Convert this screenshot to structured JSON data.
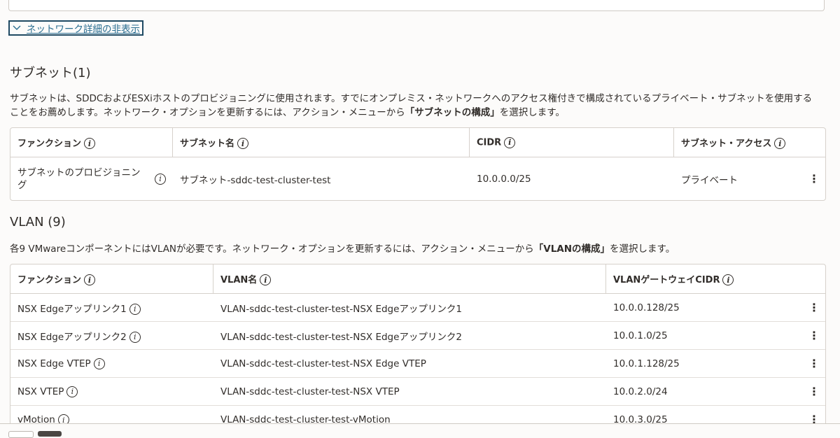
{
  "network_toggle": {
    "label": "ネットワーク詳細の非表示",
    "icon": "chevron-down-icon"
  },
  "subnet_section": {
    "title": "サブネット(1)",
    "desc_line1": "サブネットは、SDDCおよびESXiホストのプロビジョニングに使用されます。すでにオンプレミス・ネットワークへのアクセス権付きで構成されているプライベート・サブネットを使用する",
    "desc_line2_pre": "ことをお薦めします。ネットワーク・オプションを更新するには、アクション・メニューから",
    "desc_line2_bold": "「サブネットの構成」",
    "desc_line2_post": "を選択します。",
    "headers": {
      "function": "ファンクション",
      "name": "サブネット名",
      "cidr": "CIDR",
      "access": "サブネット・アクセス"
    },
    "rows": [
      {
        "function_line1": "サブネットのプロビジョニン",
        "function_line2": "グ",
        "name": "サブネット-sddc-test-cluster-test",
        "cidr": "10.0.0.0/25",
        "access": "プライベート"
      }
    ]
  },
  "vlan_section": {
    "title": "VLAN (9)",
    "desc_pre": "各9 VMwareコンポーネントにはVLANが必要です。ネットワーク・オプションを更新するには、アクション・メニューから",
    "desc_bold": "「VLANの構成」",
    "desc_post": "を選択します。",
    "headers": {
      "function": "ファンクション",
      "name": "VLAN名",
      "cidr": "VLANゲートウェイCIDR"
    },
    "rows": [
      {
        "function": "NSX Edgeアップリンク1",
        "name": "VLAN-sddc-test-cluster-test-NSX Edgeアップリンク1",
        "cidr": "10.0.0.128/25"
      },
      {
        "function": "NSX Edgeアップリンク2",
        "name": "VLAN-sddc-test-cluster-test-NSX Edgeアップリンク2",
        "cidr": "10.0.1.0/25"
      },
      {
        "function": "NSX Edge VTEP",
        "name": "VLAN-sddc-test-cluster-test-NSX Edge VTEP",
        "cidr": "10.0.1.128/25"
      },
      {
        "function": "NSX VTEP",
        "name": "VLAN-sddc-test-cluster-test-NSX VTEP",
        "cidr": "10.0.2.0/24"
      },
      {
        "function": "vMotion",
        "name": "VLAN-sddc-test-cluster-test-vMotion",
        "cidr": "10.0.3.0/25"
      }
    ]
  },
  "icons": {
    "info": "i",
    "kebab": "⋮"
  }
}
